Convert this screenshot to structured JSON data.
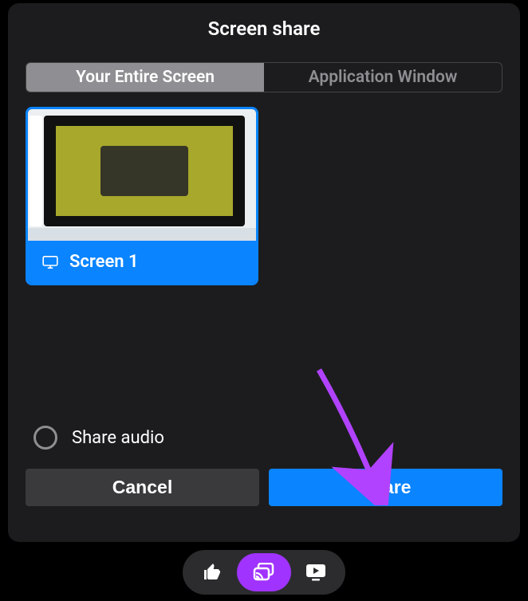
{
  "dialog": {
    "title": "Screen share",
    "tabs": {
      "entire_screen": "Your Entire Screen",
      "app_window": "Application Window"
    },
    "screen_label": "Screen 1",
    "share_audio": "Share audio",
    "cancel": "Cancel",
    "share": "Share"
  }
}
